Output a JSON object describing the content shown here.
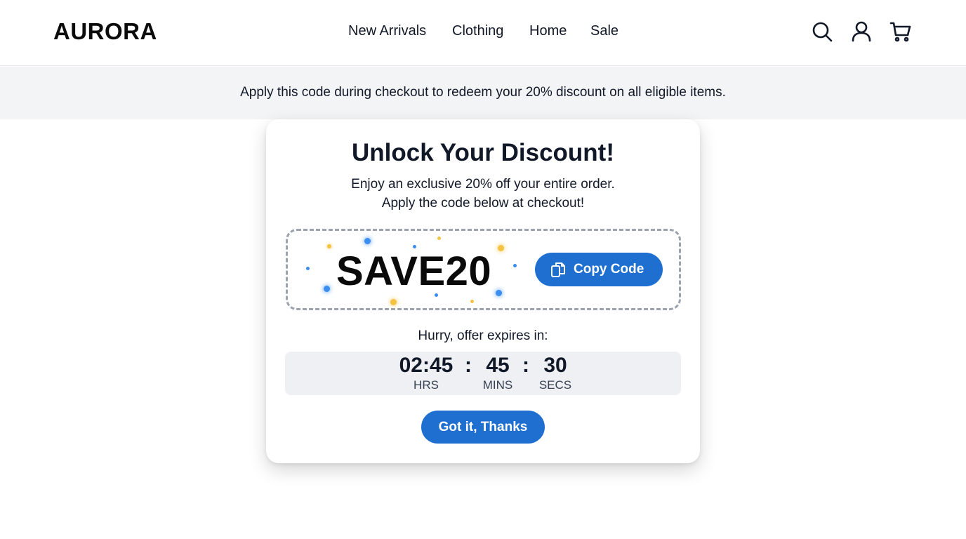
{
  "header": {
    "logo": "AURORA",
    "nav": [
      {
        "label": "New Arrivals"
      },
      {
        "label": "Clothing"
      },
      {
        "label": "Home"
      },
      {
        "label": "Sale"
      }
    ],
    "icons": [
      "search-icon",
      "user-icon",
      "cart-icon"
    ]
  },
  "banner": {
    "text": "Apply this code during checkout to redeem your 20% discount on all eligible items."
  },
  "modal": {
    "title": "Unlock Your Discount!",
    "subtitle_line1": "Enjoy an exclusive 20% off your entire order.",
    "subtitle_line2": "Apply the code below at checkout!",
    "code": "SAVE20",
    "copy_button": {
      "label": "Copy Code",
      "icon": "copy-icon"
    },
    "countdown": {
      "label": "Hurry, offer expires in:",
      "hours": "02:45",
      "hours_unit": "HRS",
      "minutes": "45",
      "minutes_unit": "MINS",
      "seconds": "30",
      "seconds_unit": "SECS",
      "separator": ":"
    },
    "dismiss_button": {
      "label": "Got it, Thanks"
    }
  },
  "colors": {
    "accent": "#1f6fd1",
    "banner_bg": "#f3f4f6",
    "timer_bg": "#eef0f3",
    "confetti_blue": "#3b8ef0",
    "confetti_gold": "#f5c242"
  }
}
